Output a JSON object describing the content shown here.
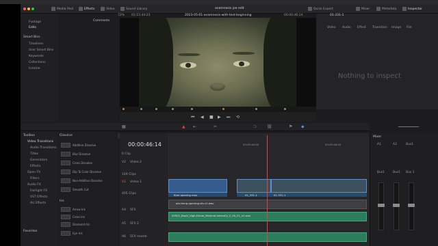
{
  "app": {
    "project_title": "anamnesis joe edit",
    "viewer_zoom": "72%",
    "source_timecode": "01:15:44:23",
    "timeline_name": "2023-05-01-anamnesis-with-test-beginning",
    "record_timecode": "00:00:46:14",
    "frame_counter": "01-331-1",
    "timeline_timecode": "00:00:46:14"
  },
  "toolbar": {
    "media_pool": "Media Pool",
    "effects": "Effects",
    "video": "Video",
    "sound_library": "Sound Library",
    "quick_export": "Quick Export",
    "mixer": "Mixer",
    "metadata": "Metadata",
    "inspector": "Inspector"
  },
  "left_panel": {
    "items": [
      "Footage",
      "Edits"
    ],
    "comments": "Comments",
    "smart_bins": "Smart Bins",
    "bins": [
      "Timelines",
      "User Smart Bins",
      "Keywords",
      "Collections",
      "Iceome"
    ]
  },
  "inspector": {
    "tabs": [
      "Video",
      "Audio",
      "Effect",
      "Transition",
      "Image",
      "File"
    ],
    "empty_message": "Nothing to inspect"
  },
  "toolbox": {
    "title": "Toolbox",
    "items": [
      "Video Transitions",
      "Audio Transitions",
      "Titles",
      "Generators",
      "Effects",
      "Open FX",
      "Filters",
      "Audio FX",
      "Fairlight FX",
      "VST Effects",
      "AU Effects"
    ],
    "favorites": "Favorites",
    "dissolve_header": "Dissolve",
    "dissolves": [
      "Additive Dissolve",
      "Blur Dissolve",
      "Cross Dissolve",
      "Dip To Color Dissolve",
      "Non-Additive Dissolve",
      "Smooth Cut"
    ],
    "iris_header": "Iris",
    "iris": [
      "Arrow Iris",
      "Cross Iris",
      "Diamond Iris",
      "Eye Iris"
    ]
  },
  "tracks": {
    "v2": {
      "id": "V2",
      "name": "Video 2",
      "clips": "0 Clip"
    },
    "v1": {
      "id": "V1",
      "name": "Video 1",
      "clips": "149 Clips"
    },
    "a1": {
      "id": "A1",
      "name": "",
      "clips": "405 Clips"
    },
    "a4": {
      "id": "A4",
      "name": "SFX"
    },
    "a5": {
      "id": "A5",
      "name": "SFX 2"
    },
    "a6": {
      "id": "A6",
      "name": "SFX reverb"
    }
  },
  "timeline_ruler": {
    "marks": [
      "00:00:40:00",
      "00:00:48:00"
    ]
  },
  "clips": {
    "v1_a": "Blue opening mov",
    "v1_b": "01_331-1",
    "v1_c": "01-331-1",
    "a4": "pie-temp-opening.sfx-v1.wav",
    "a5": "00501_Bauti_High-Drone_Minimal-Intensity_0_00_01_v2.wav"
  },
  "mixer": {
    "title": "Mixer",
    "channels": [
      "A1",
      "A2",
      "Bus1"
    ],
    "sends": [
      "Bus1",
      "Bus1",
      "Bus 1"
    ]
  },
  "colors": {
    "accent_blue": "#5d8fc9",
    "audio_green": "#2b7d5b",
    "playhead_red": "#e8403c",
    "bg": "#1c1c1e"
  }
}
